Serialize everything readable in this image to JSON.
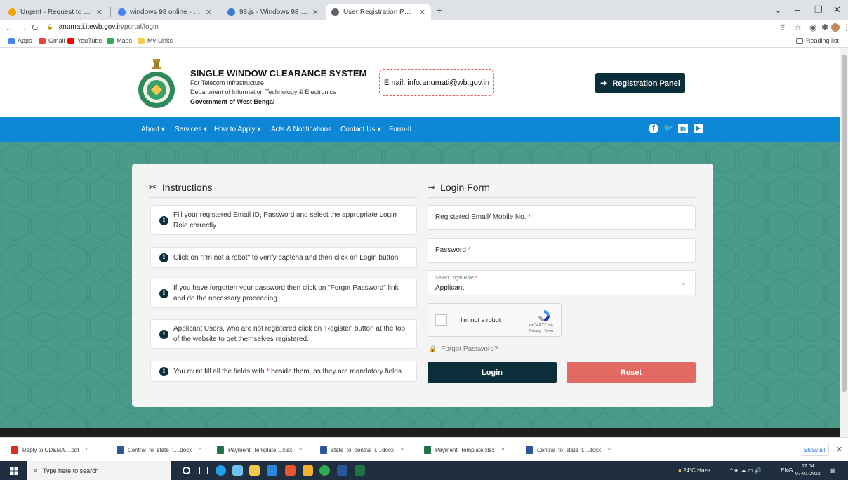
{
  "browser": {
    "tabs": [
      {
        "label": "Urgent - Request to provide som",
        "color": "#f4a400"
      },
      {
        "label": "windows 98 online - Google Sea",
        "color": "#4285f4"
      },
      {
        "label": "98.js - Windows 98 Online",
        "color": "#3a7bd5"
      },
      {
        "label": "User Registration Page",
        "color": "#5f6368"
      }
    ],
    "url_host": "anumati.itewb.gov.in",
    "url_path": "/portal/login",
    "bookmarks": [
      "Apps",
      "Gmail",
      "YouTube",
      "Maps",
      "My-Links"
    ],
    "reading_list": "Reading list"
  },
  "site": {
    "title": "SINGLE WINDOW CLEARANCE SYSTEM",
    "subtitle1": "For Telecom Infrastructure",
    "subtitle2": "Department of Information Technology & Electronics",
    "govt": "Government of West Bengal",
    "email": "Email: info.anumati@wb.gov.in",
    "registration_button": "Registration Panel",
    "nav": [
      "About",
      "Services",
      "How to Apply",
      "Acts & Notifications",
      "Contact Us",
      "Form-II"
    ]
  },
  "instructions": {
    "title": "Instructions",
    "items": [
      "Fill your registered Email ID, Password and select the appropriate Login Role correctly.",
      "Click on \"I'm not a robot\" to verify captcha and then click on Login button.",
      "If you have forgotten your password then click on \"Forgot Password\" link and do the necessary proceeding.",
      "Applicant Users, who are not registered click on 'Register' button at the top of the website to get themselves registered.",
      "You must fill all the fields with",
      "beside them, as they are mandatory fields."
    ]
  },
  "login": {
    "title": "Login Form",
    "email_placeholder": "Registered Email/ Mobile No.",
    "password_placeholder": "Password",
    "role_label": "Select Login Role",
    "role_value": "Applicant",
    "captcha_label": "I'm not a robot",
    "captcha_brand": "reCAPTCHA",
    "captcha_terms": "Privacy - Terms",
    "forgot": "Forgot Password?",
    "login_button": "Login",
    "reset_button": "Reset",
    "required_mark": "*"
  },
  "downloads": {
    "items": [
      {
        "name": "Reply to UD&MA....pdf",
        "color": "#d93025"
      },
      {
        "name": "Central_to_state_I....docx",
        "color": "#2b579a"
      },
      {
        "name": "Payment_Template....xlsx",
        "color": "#217346"
      },
      {
        "name": "state_to_central_i....docx",
        "color": "#2b579a"
      },
      {
        "name": "Payment_Template.xlsx",
        "color": "#217346"
      },
      {
        "name": "Central_to_state_I....docx",
        "color": "#2b579a"
      }
    ],
    "show_all": "Show all"
  },
  "taskbar": {
    "search_placeholder": "Type here to search",
    "weather": "24°C Haze",
    "lang": "ENG",
    "time": "12:04",
    "date": "07-01-2022"
  }
}
